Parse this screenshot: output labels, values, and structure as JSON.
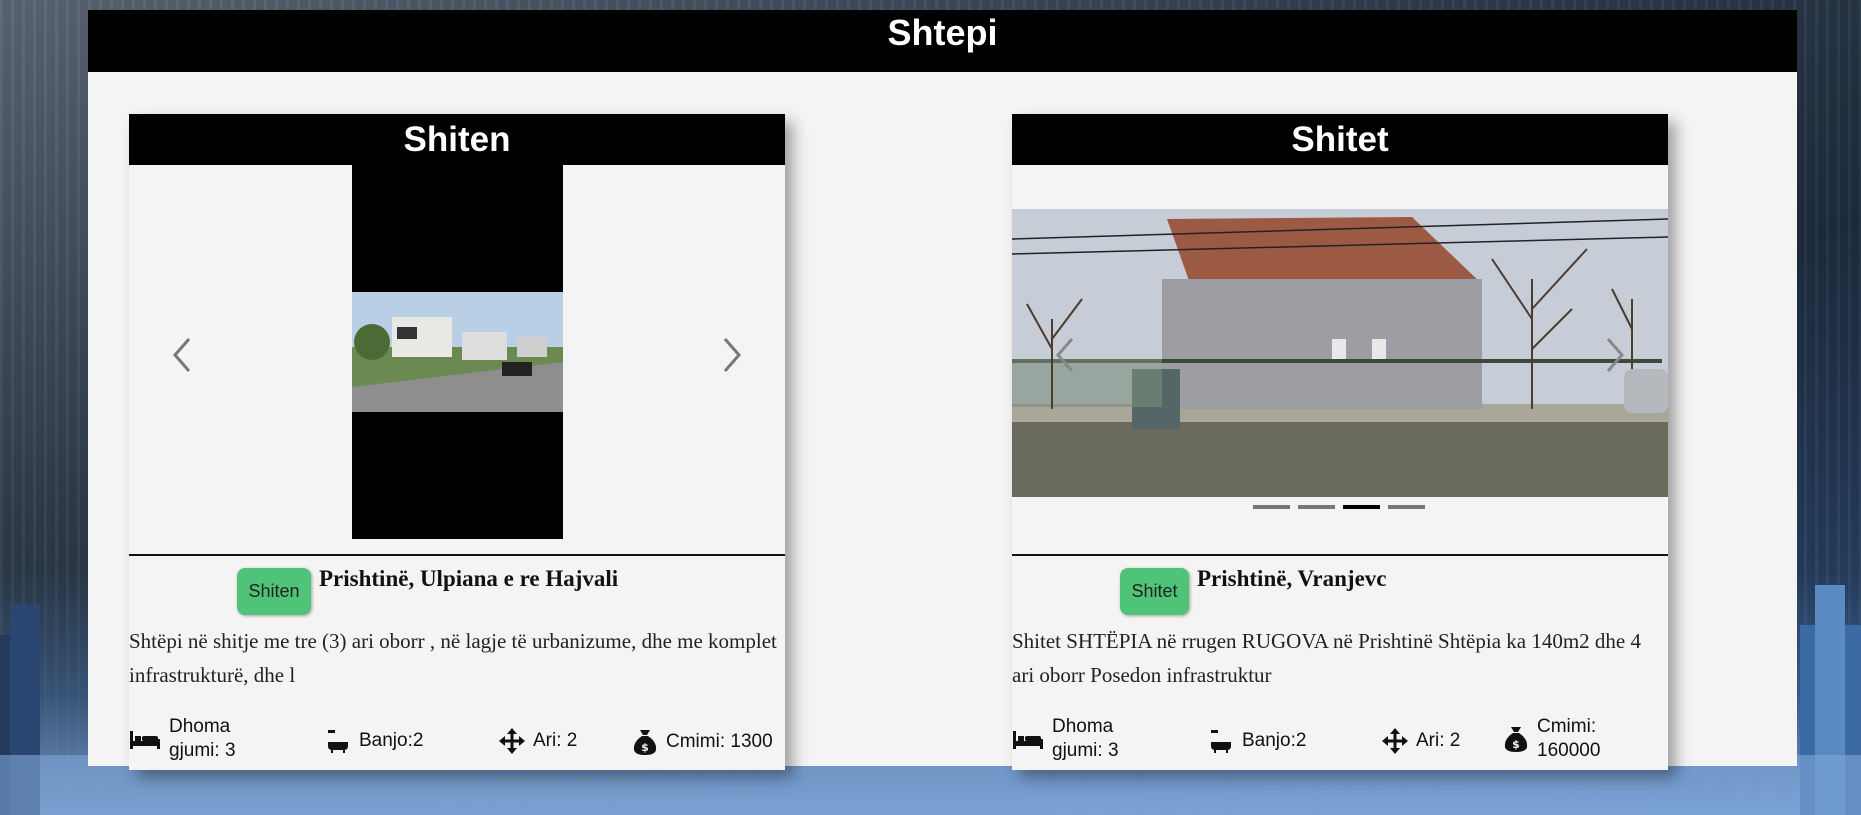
{
  "page": {
    "title": "Shtepi"
  },
  "cards": [
    {
      "title": "Shiten",
      "badge": "Shiten",
      "location": "Prishtinë,  Ulpiana e re Hajvali",
      "description": "Shtëpi në shitje me tre (3) ari oborr , në lagje të urbanizume, dhe me komplet infrastrukturë, dhe l",
      "features": {
        "rooms": "Dhoma gjumi: 3",
        "bath": "Banjo:2",
        "area": "Ari: 2",
        "price": "Cmimi: 1300"
      }
    },
    {
      "title": "Shitet",
      "badge": "Shitet",
      "location": "Prishtinë,  Vranjevc",
      "description": "Shitet SHTËPIA në rrugen RUGOVA në Prishtinë Shtëpia ka 140m2 dhe 4 ari oborr Posedon infrastruktur",
      "features": {
        "rooms": "Dhoma gjumi: 3",
        "bath": "Banjo:2",
        "area": "Ari: 2",
        "price": "Cmimi: 160000"
      },
      "carousel": {
        "slides": 4,
        "active_index": 2
      }
    }
  ],
  "colors": {
    "header_bg": "#000000",
    "panel_bg": "#f4f4f4",
    "badge_bg": "#4fc378",
    "indicator_active": "#000000",
    "indicator_inactive": "#777777"
  },
  "icons": [
    "chevron-left-icon",
    "chevron-right-icon",
    "bed-icon",
    "bathtub-icon",
    "arrows-move-icon",
    "money-bag-icon"
  ]
}
